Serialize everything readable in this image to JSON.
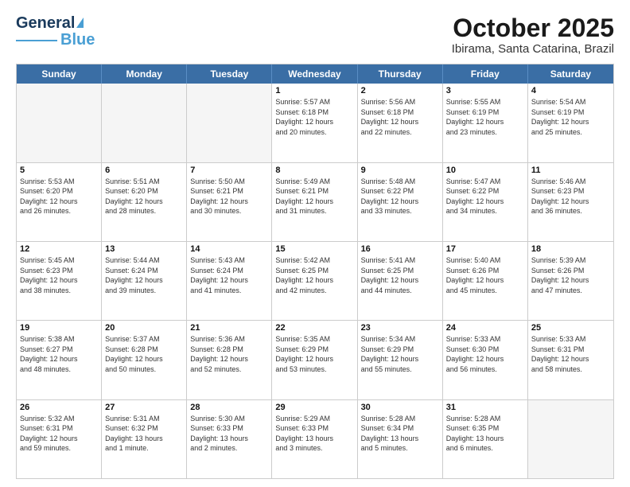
{
  "header": {
    "logo_line1": "General",
    "logo_line2": "Blue",
    "month": "October 2025",
    "location": "Ibirama, Santa Catarina, Brazil"
  },
  "weekdays": [
    "Sunday",
    "Monday",
    "Tuesday",
    "Wednesday",
    "Thursday",
    "Friday",
    "Saturday"
  ],
  "rows": [
    [
      {
        "day": "",
        "info": "",
        "empty": true
      },
      {
        "day": "",
        "info": "",
        "empty": true
      },
      {
        "day": "",
        "info": "",
        "empty": true
      },
      {
        "day": "1",
        "info": "Sunrise: 5:57 AM\nSunset: 6:18 PM\nDaylight: 12 hours\nand 20 minutes.",
        "empty": false
      },
      {
        "day": "2",
        "info": "Sunrise: 5:56 AM\nSunset: 6:18 PM\nDaylight: 12 hours\nand 22 minutes.",
        "empty": false
      },
      {
        "day": "3",
        "info": "Sunrise: 5:55 AM\nSunset: 6:19 PM\nDaylight: 12 hours\nand 23 minutes.",
        "empty": false
      },
      {
        "day": "4",
        "info": "Sunrise: 5:54 AM\nSunset: 6:19 PM\nDaylight: 12 hours\nand 25 minutes.",
        "empty": false
      }
    ],
    [
      {
        "day": "5",
        "info": "Sunrise: 5:53 AM\nSunset: 6:20 PM\nDaylight: 12 hours\nand 26 minutes.",
        "empty": false
      },
      {
        "day": "6",
        "info": "Sunrise: 5:51 AM\nSunset: 6:20 PM\nDaylight: 12 hours\nand 28 minutes.",
        "empty": false
      },
      {
        "day": "7",
        "info": "Sunrise: 5:50 AM\nSunset: 6:21 PM\nDaylight: 12 hours\nand 30 minutes.",
        "empty": false
      },
      {
        "day": "8",
        "info": "Sunrise: 5:49 AM\nSunset: 6:21 PM\nDaylight: 12 hours\nand 31 minutes.",
        "empty": false
      },
      {
        "day": "9",
        "info": "Sunrise: 5:48 AM\nSunset: 6:22 PM\nDaylight: 12 hours\nand 33 minutes.",
        "empty": false
      },
      {
        "day": "10",
        "info": "Sunrise: 5:47 AM\nSunset: 6:22 PM\nDaylight: 12 hours\nand 34 minutes.",
        "empty": false
      },
      {
        "day": "11",
        "info": "Sunrise: 5:46 AM\nSunset: 6:23 PM\nDaylight: 12 hours\nand 36 minutes.",
        "empty": false
      }
    ],
    [
      {
        "day": "12",
        "info": "Sunrise: 5:45 AM\nSunset: 6:23 PM\nDaylight: 12 hours\nand 38 minutes.",
        "empty": false
      },
      {
        "day": "13",
        "info": "Sunrise: 5:44 AM\nSunset: 6:24 PM\nDaylight: 12 hours\nand 39 minutes.",
        "empty": false
      },
      {
        "day": "14",
        "info": "Sunrise: 5:43 AM\nSunset: 6:24 PM\nDaylight: 12 hours\nand 41 minutes.",
        "empty": false
      },
      {
        "day": "15",
        "info": "Sunrise: 5:42 AM\nSunset: 6:25 PM\nDaylight: 12 hours\nand 42 minutes.",
        "empty": false
      },
      {
        "day": "16",
        "info": "Sunrise: 5:41 AM\nSunset: 6:25 PM\nDaylight: 12 hours\nand 44 minutes.",
        "empty": false
      },
      {
        "day": "17",
        "info": "Sunrise: 5:40 AM\nSunset: 6:26 PM\nDaylight: 12 hours\nand 45 minutes.",
        "empty": false
      },
      {
        "day": "18",
        "info": "Sunrise: 5:39 AM\nSunset: 6:26 PM\nDaylight: 12 hours\nand 47 minutes.",
        "empty": false
      }
    ],
    [
      {
        "day": "19",
        "info": "Sunrise: 5:38 AM\nSunset: 6:27 PM\nDaylight: 12 hours\nand 48 minutes.",
        "empty": false
      },
      {
        "day": "20",
        "info": "Sunrise: 5:37 AM\nSunset: 6:28 PM\nDaylight: 12 hours\nand 50 minutes.",
        "empty": false
      },
      {
        "day": "21",
        "info": "Sunrise: 5:36 AM\nSunset: 6:28 PM\nDaylight: 12 hours\nand 52 minutes.",
        "empty": false
      },
      {
        "day": "22",
        "info": "Sunrise: 5:35 AM\nSunset: 6:29 PM\nDaylight: 12 hours\nand 53 minutes.",
        "empty": false
      },
      {
        "day": "23",
        "info": "Sunrise: 5:34 AM\nSunset: 6:29 PM\nDaylight: 12 hours\nand 55 minutes.",
        "empty": false
      },
      {
        "day": "24",
        "info": "Sunrise: 5:33 AM\nSunset: 6:30 PM\nDaylight: 12 hours\nand 56 minutes.",
        "empty": false
      },
      {
        "day": "25",
        "info": "Sunrise: 5:33 AM\nSunset: 6:31 PM\nDaylight: 12 hours\nand 58 minutes.",
        "empty": false
      }
    ],
    [
      {
        "day": "26",
        "info": "Sunrise: 5:32 AM\nSunset: 6:31 PM\nDaylight: 12 hours\nand 59 minutes.",
        "empty": false
      },
      {
        "day": "27",
        "info": "Sunrise: 5:31 AM\nSunset: 6:32 PM\nDaylight: 13 hours\nand 1 minute.",
        "empty": false
      },
      {
        "day": "28",
        "info": "Sunrise: 5:30 AM\nSunset: 6:33 PM\nDaylight: 13 hours\nand 2 minutes.",
        "empty": false
      },
      {
        "day": "29",
        "info": "Sunrise: 5:29 AM\nSunset: 6:33 PM\nDaylight: 13 hours\nand 3 minutes.",
        "empty": false
      },
      {
        "day": "30",
        "info": "Sunrise: 5:28 AM\nSunset: 6:34 PM\nDaylight: 13 hours\nand 5 minutes.",
        "empty": false
      },
      {
        "day": "31",
        "info": "Sunrise: 5:28 AM\nSunset: 6:35 PM\nDaylight: 13 hours\nand 6 minutes.",
        "empty": false
      },
      {
        "day": "",
        "info": "",
        "empty": true
      }
    ]
  ]
}
